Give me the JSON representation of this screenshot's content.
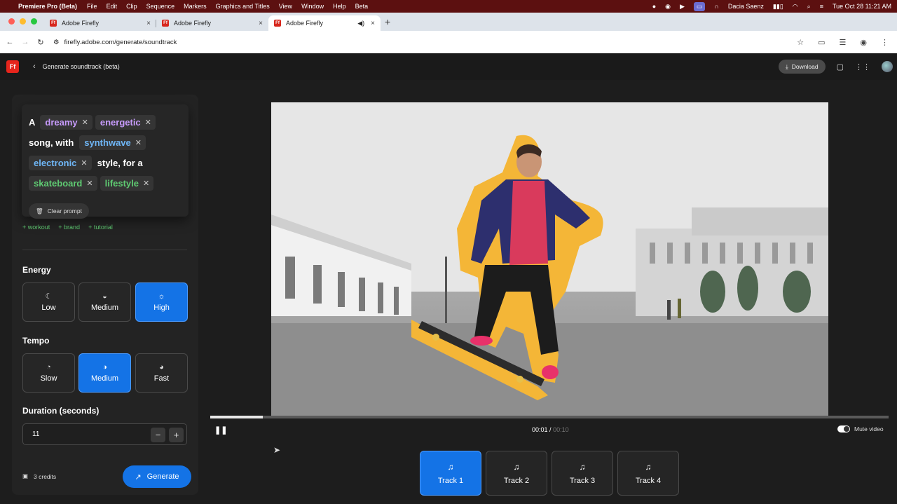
{
  "menubar": {
    "app_name": "Premiere Pro (Beta)",
    "items": [
      "File",
      "Edit",
      "Clip",
      "Sequence",
      "Markers",
      "Graphics and Titles",
      "View",
      "Window",
      "Help",
      "Beta"
    ],
    "user": "Dacia Saenz",
    "datetime": "Tue Oct 28  11:21 AM"
  },
  "browser": {
    "tabs": [
      {
        "title": "Adobe Firefly"
      },
      {
        "title": "Adobe Firefly"
      },
      {
        "title": "Adobe Firefly"
      }
    ],
    "url": "firefly.adobe.com/generate/soundtrack"
  },
  "header": {
    "logo": "Ff",
    "title": "Generate soundtrack (beta)",
    "download_label": "Download"
  },
  "prompt": {
    "word_a": "A",
    "chip_dreamy": "dreamy",
    "chip_energetic": "energetic",
    "text_song": "song, with",
    "chip_synthwave": "synthwave",
    "chip_electronic": "electronic",
    "text_style": "style, for a",
    "chip_skateboard": "skateboard",
    "chip_lifestyle": "lifestyle",
    "clear_label": "Clear prompt"
  },
  "suggestions": [
    "+ workout",
    "+ brand",
    "+ tutorial"
  ],
  "energy": {
    "label": "Energy",
    "options": [
      "Low",
      "Medium",
      "High"
    ],
    "selected": "High"
  },
  "tempo": {
    "label": "Tempo",
    "options": [
      "Slow",
      "Medium",
      "Fast"
    ],
    "selected": "Medium"
  },
  "duration": {
    "label": "Duration (seconds)",
    "value": "11"
  },
  "footer": {
    "credits": "3 credits",
    "generate_label": "Generate"
  },
  "player": {
    "current_time": "00:01",
    "total_time": "00:10",
    "progress": 0.077,
    "mute_label": "Mute video"
  },
  "tracks": [
    {
      "label": "Track 1"
    },
    {
      "label": "Track 2"
    },
    {
      "label": "Track 3"
    },
    {
      "label": "Track 4"
    }
  ],
  "colors": {
    "accent": "#1473e6",
    "chip_purple": "#c79bfb",
    "chip_blue": "#6fb6f6",
    "chip_green": "#5fca72"
  }
}
